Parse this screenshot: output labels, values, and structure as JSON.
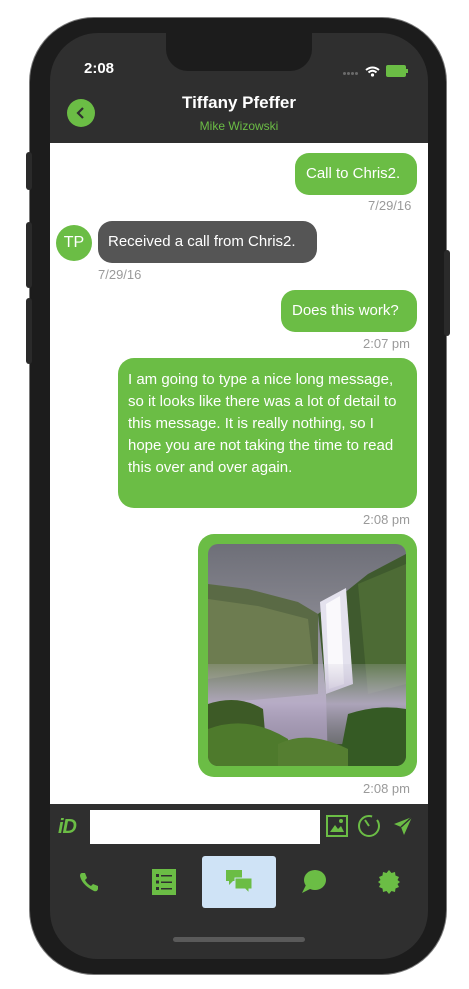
{
  "status_bar": {
    "time": "2:08"
  },
  "header": {
    "title": "Tiffany Pfeffer",
    "subtitle": "Mike Wizowski"
  },
  "messages": [
    {
      "direction": "outgoing",
      "text": "Call to Chris2.",
      "time": "7/29/16"
    },
    {
      "direction": "incoming",
      "avatar": "TP",
      "text": "Received a call from Chris2.",
      "time": "7/29/16"
    },
    {
      "direction": "outgoing",
      "text": "Does this work?",
      "time": "2:07 pm"
    },
    {
      "direction": "outgoing",
      "text": "I am going to type a nice long message, so it looks like there was a lot of detail to this message. It is really nothing, so I hope you are not taking the time to read this over and over again.",
      "time": "2:08 pm"
    },
    {
      "direction": "outgoing",
      "type": "image",
      "image": "waterfall-photo",
      "time": "2:08 pm"
    }
  ],
  "input": {
    "logo": "iD",
    "value": "",
    "placeholder": ""
  },
  "icons": {
    "back": "chevron-left-icon",
    "image_attach": "image-icon",
    "timer": "timer-icon",
    "send": "send-icon"
  },
  "tabs": [
    {
      "icon": "phone-icon",
      "active": false
    },
    {
      "icon": "list-icon",
      "active": false
    },
    {
      "icon": "chat-bubbles-icon",
      "active": true
    },
    {
      "icon": "speech-bubble-icon",
      "active": false
    },
    {
      "icon": "settings-badge-icon",
      "active": false
    }
  ],
  "colors": {
    "accent": "#6bbd45",
    "incoming_bubble": "#555555",
    "header_bg": "#2f2f2f",
    "active_tab": "#cfe3f6"
  }
}
